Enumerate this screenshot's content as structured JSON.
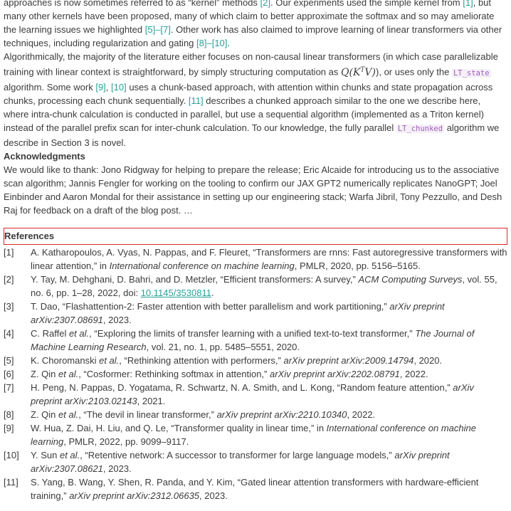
{
  "para1": {
    "s1": "approaches is now sometimes referred to as “kernel” methods ",
    "c1": "[2]",
    "s2": ". Our experiments used the simple kernel from ",
    "c2": "[1]",
    "s3": ", but many other kernels have been proposed, many of which claim to better approximate the softmax and so may ameliorate the learning issues we highlighted ",
    "c3": "[5]–[7]",
    "s4": ". Other work has also claimed to improve learning of linear transformers via other techniques, including regularization and gating ",
    "c4": "[8]–[10]",
    "s5": "."
  },
  "para2": {
    "s1": "Algorithmically, the majority of the literature either focuses on non-causal linear transformers (in which case parallelizable training with linear context is straightforward, by simply structuring computation as ",
    "math_q": "Q",
    "math_k": "K",
    "math_t": "T",
    "math_v": "V",
    "s2": "), or uses only the ",
    "code1": "LT_state",
    "s3": " algorithm. Some work ",
    "c1": "[9]",
    "s3b": ", ",
    "c2": "[10]",
    "s4": " uses a chunk-based approach, with attention within chunks and state propagation across chunks, processing each chunk sequentially. ",
    "c3": "[11]",
    "s5": " describes a chunked approach similar to the one we describe here, where intra-chunk calculation is conducted in parallel, but use a sequential algorithm (implemented as a Triton kernel) instead of the parallel prefix scan for inter-chunk calculation. To our knowledge, the fully parallel ",
    "code2": "LT_chunked",
    "s6": " algorithm we describe in Section 3 is novel."
  },
  "acknowledgments": {
    "heading": "Acknowledgments",
    "text": "We would like to thank: Jono Ridgway for helping to prepare the release; Eric Alcaide for introducing us to the associative scan algorithm; Jannis Fengler for working on the tooling to confirm our JAX GPT2 numerically replicates NanoGPT; Joel Einbinder and Aaron Mondal for their assistance in setting up our engineering stack; Warfa Jibril, Tony Pezzullo, and Desh Raj for feedback on a draft of the blog post. …"
  },
  "references": {
    "heading": "References",
    "items": [
      {
        "num": "[1]",
        "a": "A. Katharopoulos, A. Vyas, N. Pappas, and F. Fleuret, “Transformers are rnns: Fast autoregressive transformers with linear attention,” in ",
        "v": "International conference on machine learning",
        "b": ", PMLR, 2020, pp. 5156–5165."
      },
      {
        "num": "[2]",
        "a": "Y. Tay, M. Dehghani, D. Bahri, and D. Metzler, “Efficient transformers: A survey,” ",
        "v": "ACM Computing Surveys",
        "b": ", vol. 55, no. 6, pp. 1–28, 2022, doi: ",
        "doi": "10.1145/3530811",
        "c": "."
      },
      {
        "num": "[3]",
        "a": "T. Dao, “Flashattention-2: Faster attention with better parallelism and work partitioning,” ",
        "v": "arXiv preprint arXiv:2307.08691",
        "b": ", 2023."
      },
      {
        "num": "[4]",
        "a": "C. Raffel ",
        "etal": "et al.",
        "a2": ", “Exploring the limits of transfer learning with a unified text-to-text transformer,” ",
        "v": "The Journal of Machine Learning Research",
        "b": ", vol. 21, no. 1, pp. 5485–5551, 2020."
      },
      {
        "num": "[5]",
        "a": "K. Choromanski ",
        "etal": "et al.",
        "a2": ", “Rethinking attention with performers,” ",
        "v": "arXiv preprint arXiv:2009.14794",
        "b": ", 2020."
      },
      {
        "num": "[6]",
        "a": "Z. Qin ",
        "etal": "et al.",
        "a2": ", “Cosformer: Rethinking softmax in attention,” ",
        "v": "arXiv preprint arXiv:2202.08791",
        "b": ", 2022."
      },
      {
        "num": "[7]",
        "a": "H. Peng, N. Pappas, D. Yogatama, R. Schwartz, N. A. Smith, and L. Kong, “Random feature attention,” ",
        "v": "arXiv preprint arXiv:2103.02143",
        "b": ", 2021."
      },
      {
        "num": "[8]",
        "a": "Z. Qin ",
        "etal": "et al.",
        "a2": ", “The devil in linear transformer,” ",
        "v": "arXiv preprint arXiv:2210.10340",
        "b": ", 2022."
      },
      {
        "num": "[9]",
        "a": "W. Hua, Z. Dai, H. Liu, and Q. Le, “Transformer quality in linear time,” in ",
        "v": "International conference on machine learning",
        "b": ", PMLR, 2022, pp. 9099–9117."
      },
      {
        "num": "[10]",
        "a": "Y. Sun ",
        "etal": "et al.",
        "a2": ", “Retentive network: A successor to transformer for large language models,” ",
        "v": "arXiv preprint arXiv:2307.08621",
        "b": ", 2023."
      },
      {
        "num": "[11]",
        "a": "S. Yang, B. Wang, Y. Shen, R. Panda, and Y. Kim, “Gated linear attention transformers with hardware-efficient training,” ",
        "v": "arXiv preprint arXiv:2312.06635",
        "b": ", 2023."
      }
    ]
  },
  "colors": {
    "citation": "#2aa198",
    "code": "#a35bc0",
    "highlight_box": "#d42a2a"
  }
}
